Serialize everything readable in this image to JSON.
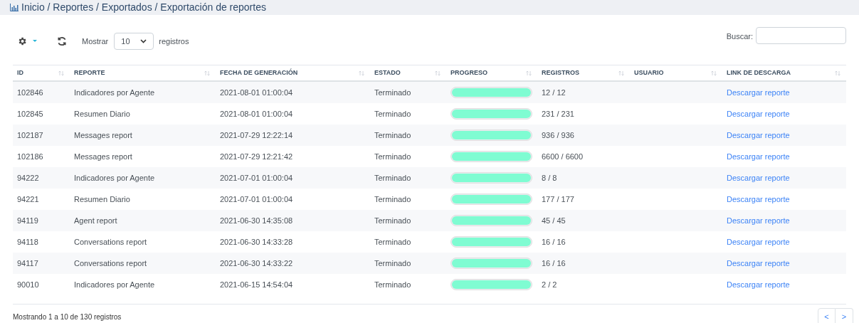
{
  "breadcrumb": "Inicio / Reportes / Exportados / Exportación de reportes",
  "toolbar": {
    "show_label": "Mostrar",
    "page_size": "10",
    "records_label": "registros",
    "search_label": "Buscar:"
  },
  "table": {
    "columns": [
      "ID",
      "REPORTE",
      "FECHA DE GENERACIÓN",
      "ESTADO",
      "PROGRESO",
      "REGISTROS",
      "USUARIO",
      "LINK DE DESCARGA"
    ],
    "rows": [
      {
        "id": "102846",
        "report": "Indicadores por Agente",
        "date": "2021-08-01 01:00:04",
        "status": "Terminado",
        "level": 1,
        "records": "12 / 12",
        "link": "Descargar reporte"
      },
      {
        "id": "102845",
        "report": "Resumen Diario",
        "date": "2021-08-01 01:00:04",
        "status": "Terminado",
        "level": 1,
        "records": "231 / 231",
        "link": "Descargar reporte"
      },
      {
        "id": "102187",
        "report": "Messages report",
        "date": "2021-07-29 12:22:14",
        "status": "Terminado",
        "level": 1,
        "records": "936 / 936",
        "link": "Descargar reporte"
      },
      {
        "id": "102186",
        "report": "Messages report",
        "date": "2021-07-29 12:21:42",
        "status": "Terminado",
        "level": 1,
        "records": "6600 / 6600",
        "link": "Descargar reporte"
      },
      {
        "id": "94222",
        "report": "Indicadores por Agente",
        "date": "2021-07-01 01:00:04",
        "status": "Terminado",
        "level": 1,
        "records": "8 / 8",
        "link": "Descargar reporte"
      },
      {
        "id": "94221",
        "report": "Resumen Diario",
        "date": "2021-07-01 01:00:04",
        "status": "Terminado",
        "level": 1,
        "records": "177 / 177",
        "link": "Descargar reporte"
      },
      {
        "id": "94119",
        "report": "Agent report",
        "date": "2021-06-30 14:35:08",
        "status": "Terminado",
        "level": 1,
        "records": "45 / 45",
        "link": "Descargar reporte"
      },
      {
        "id": "94118",
        "report": "Conversations report",
        "date": "2021-06-30 14:33:28",
        "status": "Terminado",
        "level": 1,
        "records": "16 / 16",
        "link": "Descargar reporte"
      },
      {
        "id": "94117",
        "report": "Conversations report",
        "date": "2021-06-30 14:33:22",
        "status": "Terminado",
        "level": 1,
        "records": "16 / 16",
        "link": "Descargar reporte"
      },
      {
        "id": "90010",
        "report": "Indicadores por Agente",
        "date": "2021-06-15 14:54:04",
        "status": "Terminado",
        "level": 1,
        "records": "2 / 2",
        "link": "Descargar reporte"
      }
    ]
  },
  "footer": {
    "info": "Mostrando 1 a 10 de 130 registros",
    "prev": "<",
    "next": ">"
  }
}
